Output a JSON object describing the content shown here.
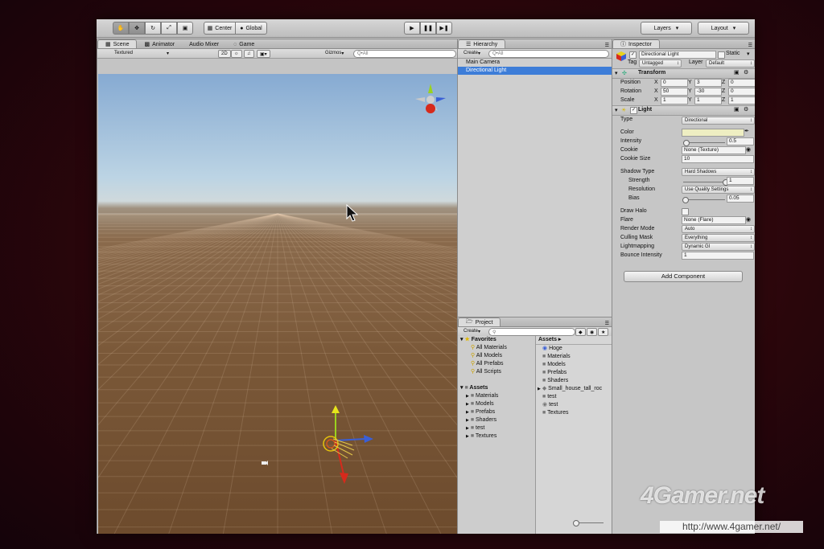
{
  "toolbar": {
    "pivot_label": "Center",
    "space_label": "Global",
    "layers_label": "Layers",
    "layout_label": "Layout"
  },
  "scene": {
    "tabs": [
      "Scene",
      "Animator",
      "Audio Mixer",
      "Game"
    ],
    "draw_mode": "Textured",
    "mode_2d": "2D",
    "gizmos_label": "Gizmos",
    "search_placeholder": "Q•All"
  },
  "hierarchy": {
    "tab": "Hierarchy",
    "create_label": "Create",
    "search_placeholder": "Q•All",
    "items": [
      "Main Camera",
      "Directional Light"
    ],
    "selected_index": 1
  },
  "project": {
    "tab": "Project",
    "create_label": "Create",
    "favorites_label": "Favorites",
    "favorites": [
      "All Materials",
      "All Models",
      "All Prefabs",
      "All Scripts"
    ],
    "assets_label": "Assets",
    "asset_folders": [
      "Materials",
      "Models",
      "Prefabs",
      "Shaders",
      "test",
      "Textures"
    ],
    "assets_header": "Assets",
    "asset_items": [
      "Hoge",
      "Materials",
      "Models",
      "Prefabs",
      "Shaders",
      "Small_house_tall_roc",
      "test",
      "test",
      "Textures"
    ]
  },
  "inspector": {
    "tab": "Inspector",
    "object_name": "Directional Light",
    "static_label": "Static",
    "tag_label": "Tag",
    "tag_value": "Untagged",
    "layer_label": "Layer",
    "layer_value": "Default",
    "transform": {
      "title": "Transform",
      "position_label": "Position",
      "position": [
        "0",
        "3",
        "0"
      ],
      "rotation_label": "Rotation",
      "rotation": [
        "50",
        "-30",
        "0"
      ],
      "scale_label": "Scale",
      "scale": [
        "1",
        "1",
        "1"
      ],
      "axis_labels": [
        "X",
        "Y",
        "Z"
      ]
    },
    "light": {
      "title": "Light",
      "type_label": "Type",
      "type_value": "Directional",
      "color_label": "Color",
      "color_value": "#eeeec2",
      "intensity_label": "Intensity",
      "intensity_value": "0.5",
      "intensity_fraction": 0.06,
      "cookie_label": "Cookie",
      "cookie_value": "None (Texture)",
      "cookie_size_label": "Cookie Size",
      "cookie_size_value": "10",
      "shadow_type_label": "Shadow Type",
      "shadow_type_value": "Hard Shadows",
      "strength_label": "Strength",
      "strength_value": "1",
      "strength_fraction": 1.0,
      "resolution_label": "Resolution",
      "resolution_value": "Use Quality Settings",
      "bias_label": "Bias",
      "bias_value": "0.05",
      "bias_fraction": 0.03,
      "draw_halo_label": "Draw Halo",
      "flare_label": "Flare",
      "flare_value": "None (Flare)",
      "render_mode_label": "Render Mode",
      "render_mode_value": "Auto",
      "culling_mask_label": "Culling Mask",
      "culling_mask_value": "Everything",
      "lightmapping_label": "Lightmapping",
      "lightmapping_value": "Dynamic GI",
      "bounce_label": "Bounce Intensity",
      "bounce_value": "1"
    },
    "add_component_label": "Add Component"
  },
  "watermark": {
    "brand": "4Gamer.net",
    "url": "http://www.4gamer.net/"
  },
  "colors": {
    "selection": "#3d7dd8",
    "panel": "#c4c4c4",
    "gizmo_x": "#d62a1c",
    "gizmo_y": "#9bd21e",
    "gizmo_z": "#3a5fd6"
  },
  "icons": [
    "hand-tool-icon",
    "move-tool-icon",
    "rotate-tool-icon",
    "scale-tool-icon",
    "rect-tool-icon",
    "play-icon",
    "pause-icon",
    "step-icon",
    "gear-icon",
    "lock-icon",
    "folder-icon",
    "star-icon",
    "search-icon",
    "cursor-icon"
  ]
}
